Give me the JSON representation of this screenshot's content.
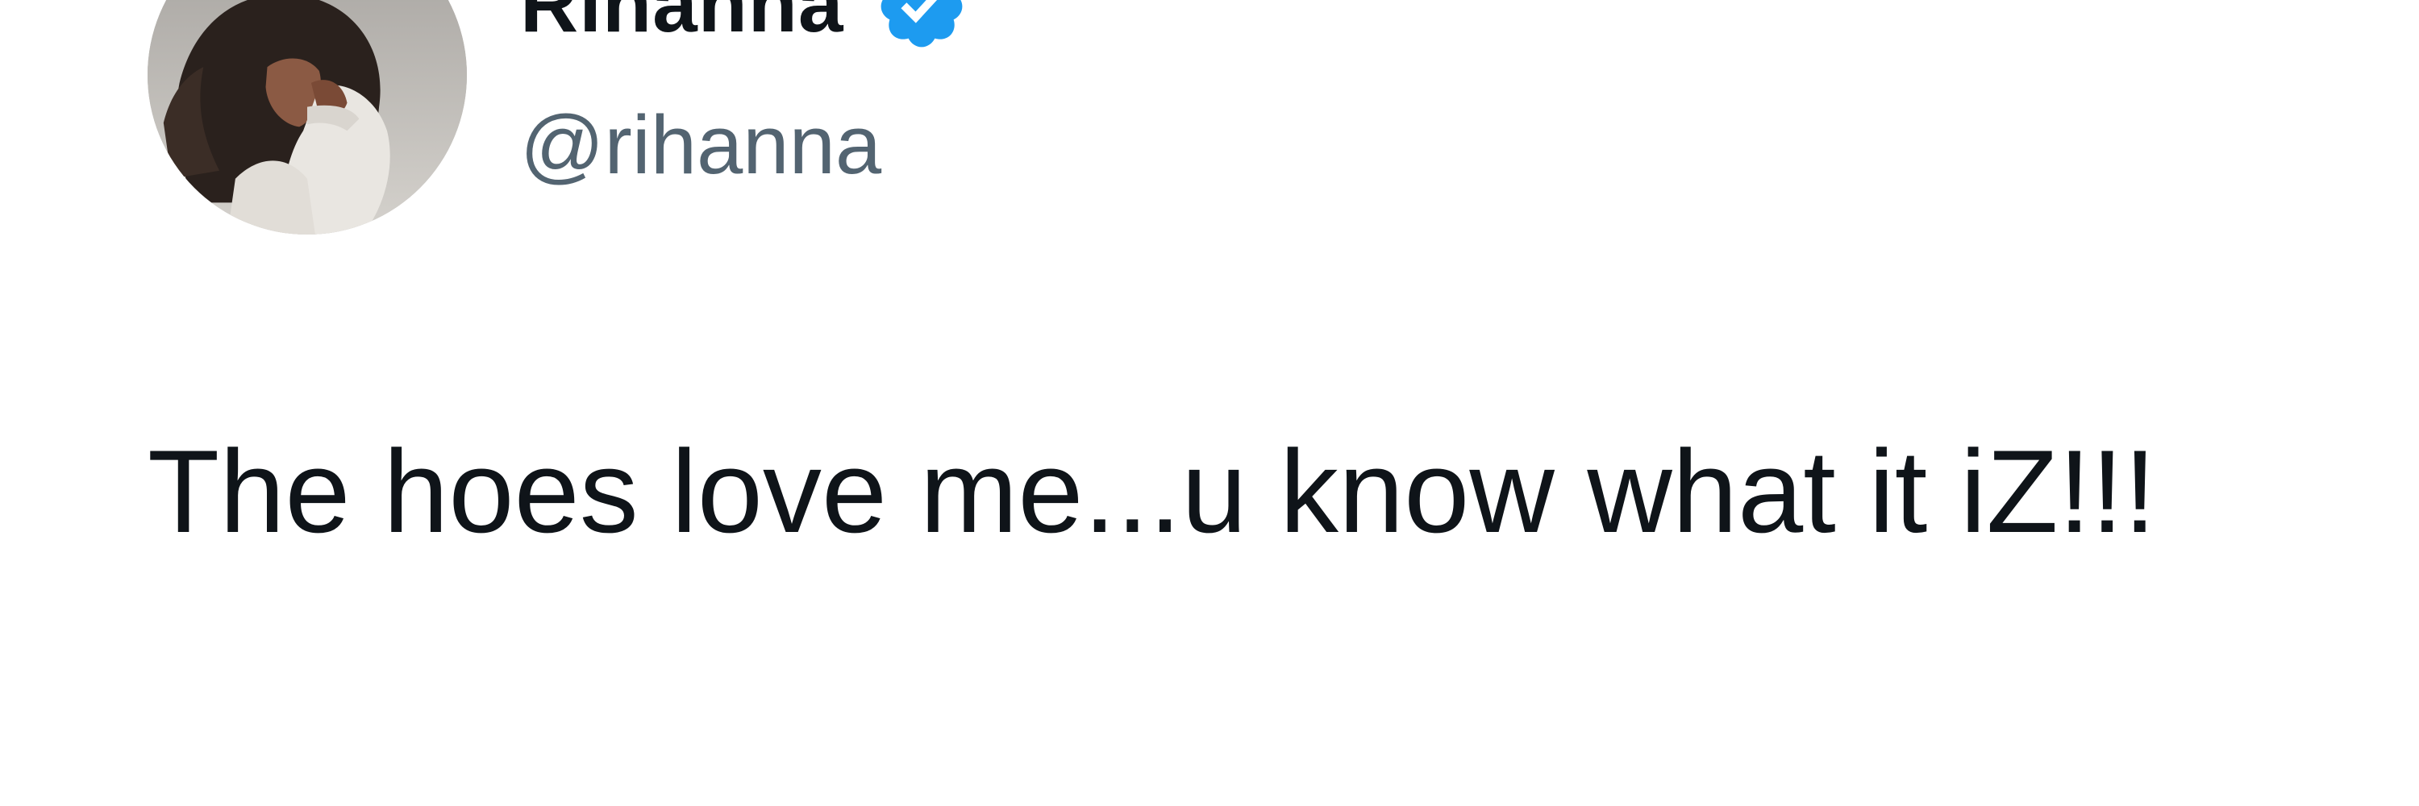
{
  "tweet": {
    "author": {
      "display_name": "Rihanna",
      "handle": "@rihanna",
      "verified": true,
      "verified_badge_icon": "verified-badge-icon",
      "avatar_icon": "profile-photo"
    },
    "text": "The hoes love me...u know what it iZ!!!"
  },
  "colors": {
    "background": "#ffffff",
    "text_primary": "#0f1419",
    "text_secondary": "#536471",
    "verified_blue": "#1d9bf0"
  }
}
